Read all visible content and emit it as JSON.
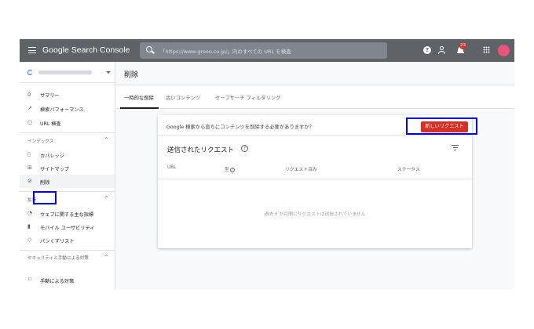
{
  "header": {
    "logo_text": "Google Search Console",
    "search_placeholder": "「https://www.grooo.co.jp/」内のすべての URL を検査",
    "help_icon": "help-icon",
    "notifications_count": "23"
  },
  "sidebar": {
    "items": [
      {
        "label": "サマリー",
        "icon": "home-icon"
      },
      {
        "label": "検索パフォーマンス",
        "icon": "trending-icon"
      },
      {
        "label": "URL 検査",
        "icon": "search-icon"
      }
    ],
    "section_index": {
      "title": "インデックス",
      "items": [
        {
          "label": "カバレッジ",
          "icon": "file-icon"
        },
        {
          "label": "サイトマップ",
          "icon": "sitemap-icon"
        },
        {
          "label": "削除",
          "icon": "eye-off-icon"
        }
      ]
    },
    "section_enhance": {
      "title": "拡張",
      "items": [
        {
          "label": "ウェブに関する主な指標",
          "icon": "gauge-icon"
        },
        {
          "label": "モバイル ユーザビリティ",
          "icon": "phone-icon"
        },
        {
          "label": "パンくずリスト",
          "icon": "layers-icon"
        }
      ]
    },
    "section_security": {
      "title": "セキュリティと手動による対策",
      "items": [
        {
          "label": "手動による対策",
          "icon": "flag-icon"
        }
      ]
    }
  },
  "main": {
    "title": "削除",
    "tabs": [
      "一時的な削除",
      "古いコンテンツ",
      "セーフサーチ フィルタリング"
    ],
    "active_tab": 0,
    "card": {
      "question": "Google 検索から直ちにコンテンツを削除する必要がありますか？",
      "new_request_label": "新しいリクエスト",
      "subtitle": "送信されたリクエスト",
      "columns": [
        "URL",
        "型",
        "リクエスト済み",
        "ステータス"
      ],
      "empty_message": "過去 6 か月間にリクエストは送信されていません"
    }
  },
  "colors": {
    "topbar": "#5f6368",
    "accent_button": "#d93025",
    "highlight_box": "#0000ee"
  }
}
